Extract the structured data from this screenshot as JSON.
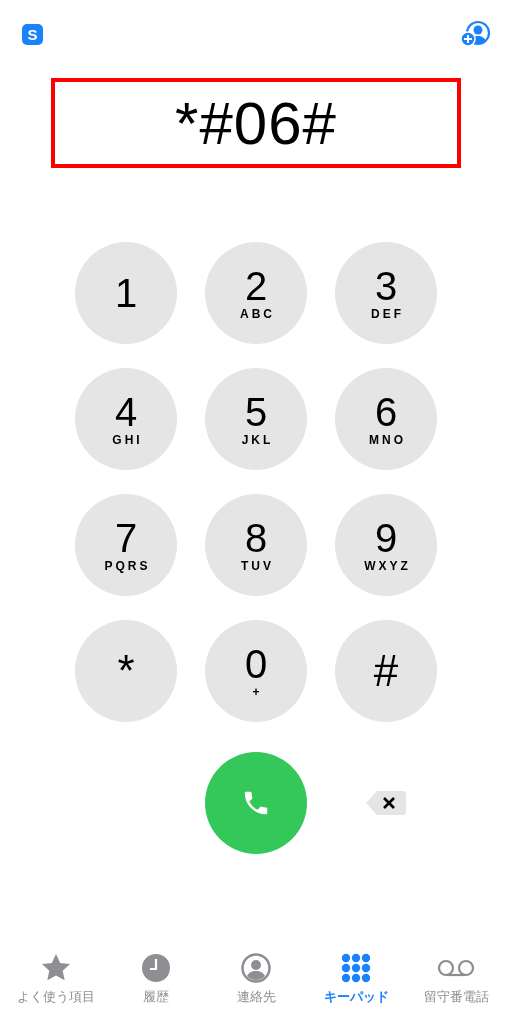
{
  "top_bar": {
    "app_badge": "S"
  },
  "display": {
    "number": "*#06#",
    "highlighted": true
  },
  "keys": [
    {
      "digit": "1"
    },
    {
      "digit": "2",
      "letters": "ABC"
    },
    {
      "digit": "3",
      "letters": "DEF"
    },
    {
      "digit": "4",
      "letters": "GHI"
    },
    {
      "digit": "5",
      "letters": "JKL"
    },
    {
      "digit": "6",
      "letters": "MNO"
    },
    {
      "digit": "7",
      "letters": "PQRS"
    },
    {
      "digit": "8",
      "letters": "TUV"
    },
    {
      "digit": "9",
      "letters": "WXYZ"
    },
    {
      "digit": "*"
    },
    {
      "digit": "0",
      "letters": "+"
    },
    {
      "digit": "#"
    }
  ],
  "tabs": [
    {
      "kind": "favorites",
      "label": "よく使う項目",
      "selected": false
    },
    {
      "kind": "recents",
      "label": "履歴",
      "selected": false
    },
    {
      "kind": "contacts",
      "label": "連絡先",
      "selected": false
    },
    {
      "kind": "keypad",
      "label": "キーパッド",
      "selected": true
    },
    {
      "kind": "voicemail",
      "label": "留守番電話",
      "selected": false
    }
  ]
}
